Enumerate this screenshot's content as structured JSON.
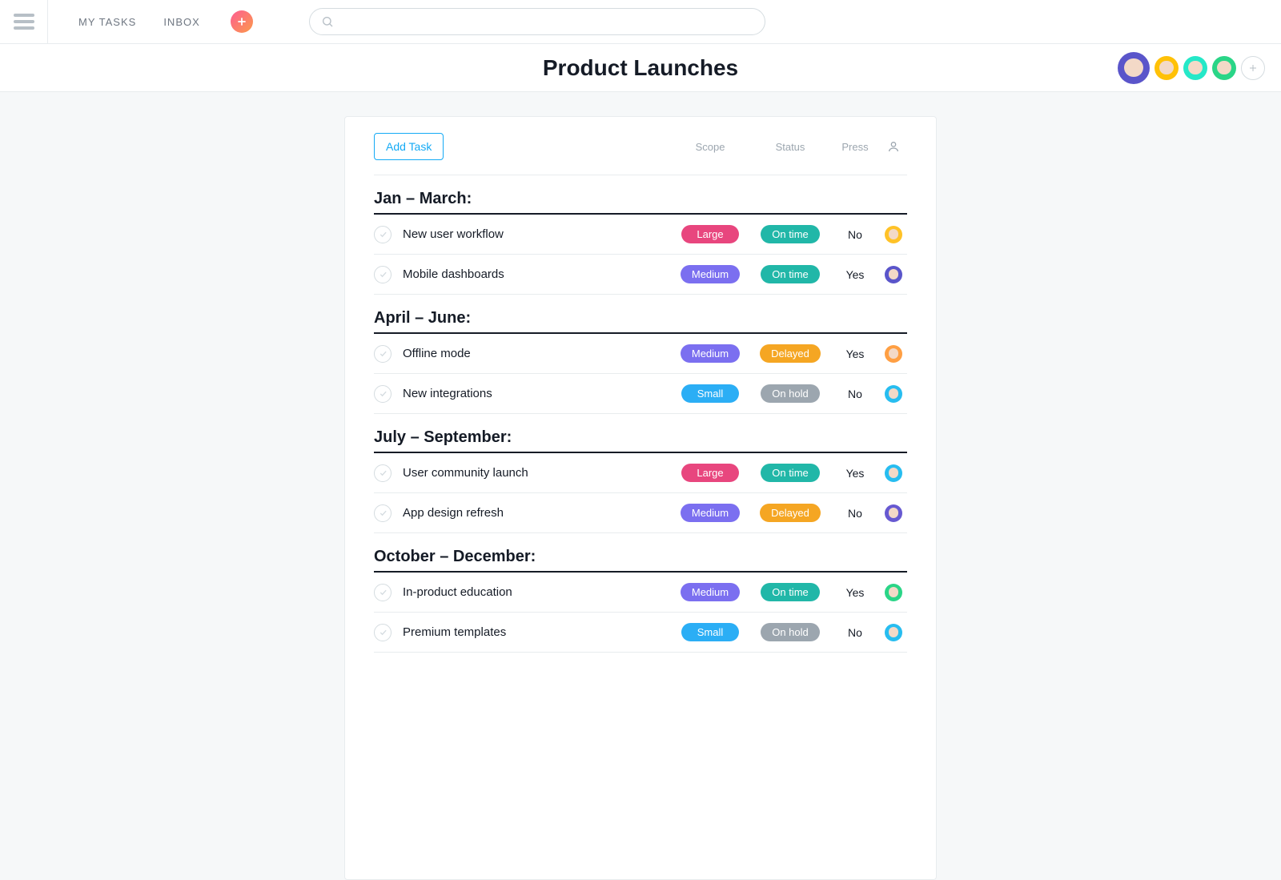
{
  "nav": {
    "my_tasks": "MY TASKS",
    "inbox": "INBOX",
    "search_placeholder": ""
  },
  "header": {
    "title": "Product Launches",
    "members": [
      {
        "bg": "#5a55ca",
        "big": true
      },
      {
        "bg": "#ffc107"
      },
      {
        "bg": "#25e8c8"
      },
      {
        "bg": "#2ad587"
      }
    ]
  },
  "card": {
    "add_task_label": "Add Task",
    "columns": {
      "scope": "Scope",
      "status": "Status",
      "press": "Press"
    }
  },
  "pill_colors": {
    "scope": {
      "Large": "#e8467e",
      "Medium": "#7b6ff0",
      "Small": "#2baef5"
    },
    "status": {
      "On time": "#21b7a8",
      "Delayed": "#f5a623",
      "On hold": "#9ca6af"
    }
  },
  "assignee_colors": {
    "a": "#ffc227",
    "b": "#5a55ca",
    "c": "#27bdf0",
    "d": "#ff9f43",
    "e": "#6759d1",
    "f": "#2ad587",
    "g": "#27bdf0"
  },
  "sections": [
    {
      "title": "Jan – March:",
      "tasks": [
        {
          "name": "New user workflow",
          "scope": "Large",
          "status": "On time",
          "press": "No",
          "assignee": "a"
        },
        {
          "name": "Mobile dashboards",
          "scope": "Medium",
          "status": "On time",
          "press": "Yes",
          "assignee": "b"
        }
      ]
    },
    {
      "title": "April – June:",
      "tasks": [
        {
          "name": "Offline mode",
          "scope": "Medium",
          "status": "Delayed",
          "press": "Yes",
          "assignee": "d"
        },
        {
          "name": "New integrations",
          "scope": "Small",
          "status": "On hold",
          "press": "No",
          "assignee": "c"
        }
      ]
    },
    {
      "title": "July – September:",
      "tasks": [
        {
          "name": "User community launch",
          "scope": "Large",
          "status": "On time",
          "press": "Yes",
          "assignee": "c"
        },
        {
          "name": "App design refresh",
          "scope": "Medium",
          "status": "Delayed",
          "press": "No",
          "assignee": "e"
        }
      ]
    },
    {
      "title": "October – December:",
      "tasks": [
        {
          "name": "In-product education",
          "scope": "Medium",
          "status": "On time",
          "press": "Yes",
          "assignee": "f"
        },
        {
          "name": "Premium templates",
          "scope": "Small",
          "status": "On hold",
          "press": "No",
          "assignee": "g"
        }
      ]
    }
  ]
}
